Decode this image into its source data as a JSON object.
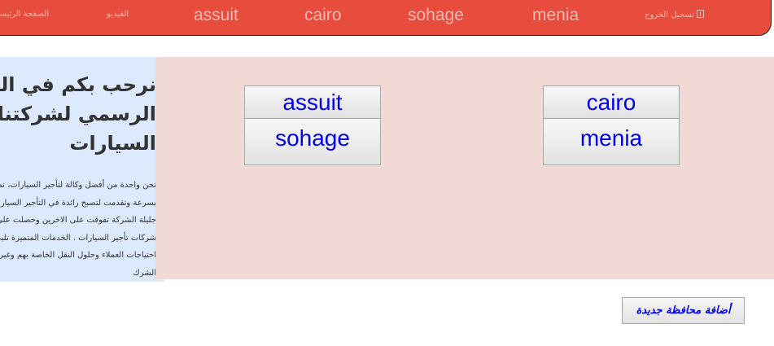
{
  "navbar": {
    "main_page": "الصفحة الرئيسية",
    "video": "الفيديو",
    "assuit": "assuit",
    "cairo": "cairo",
    "sohage": "sohage",
    "menia": "menia",
    "logout": "تسجيل الخروج",
    "logout_icon": "logout-icon"
  },
  "welcome": {
    "title_lines": [
      "نرحب بكم في الموقع",
      "الرسمي لشركتنا لتأجير",
      "السيارات"
    ],
    "text_lines": [
      "نحن واحدة من أفضل وكالة لتأجير السيارات، نمت الشركة",
      "بسرعة وتقدمت لتصبح رائدة في التأجير السيارات، وفي فترة",
      "جليلة الشركة تفوقت على الاخرين وحصلت على أفضل",
      "شركات تأجير السيارات . الخدمات المتميزة تلبي جميع",
      "احتياجات العملاء وحلول النقل الخاصة بهم وغير ذلك من",
      "الشرك"
    ]
  },
  "governorates": {
    "assuit": "assuit",
    "sohage": "sohage",
    "cairo": "cairo",
    "menia": "menia"
  },
  "actions": {
    "add_governorate": "أضافة محافظة جديدة"
  },
  "colors": {
    "navbar_bg": "#e84c3d",
    "welcome_bg": "#dde9fc",
    "gov_panel_bg": "#f1d9d6",
    "link": "#0000ee"
  }
}
